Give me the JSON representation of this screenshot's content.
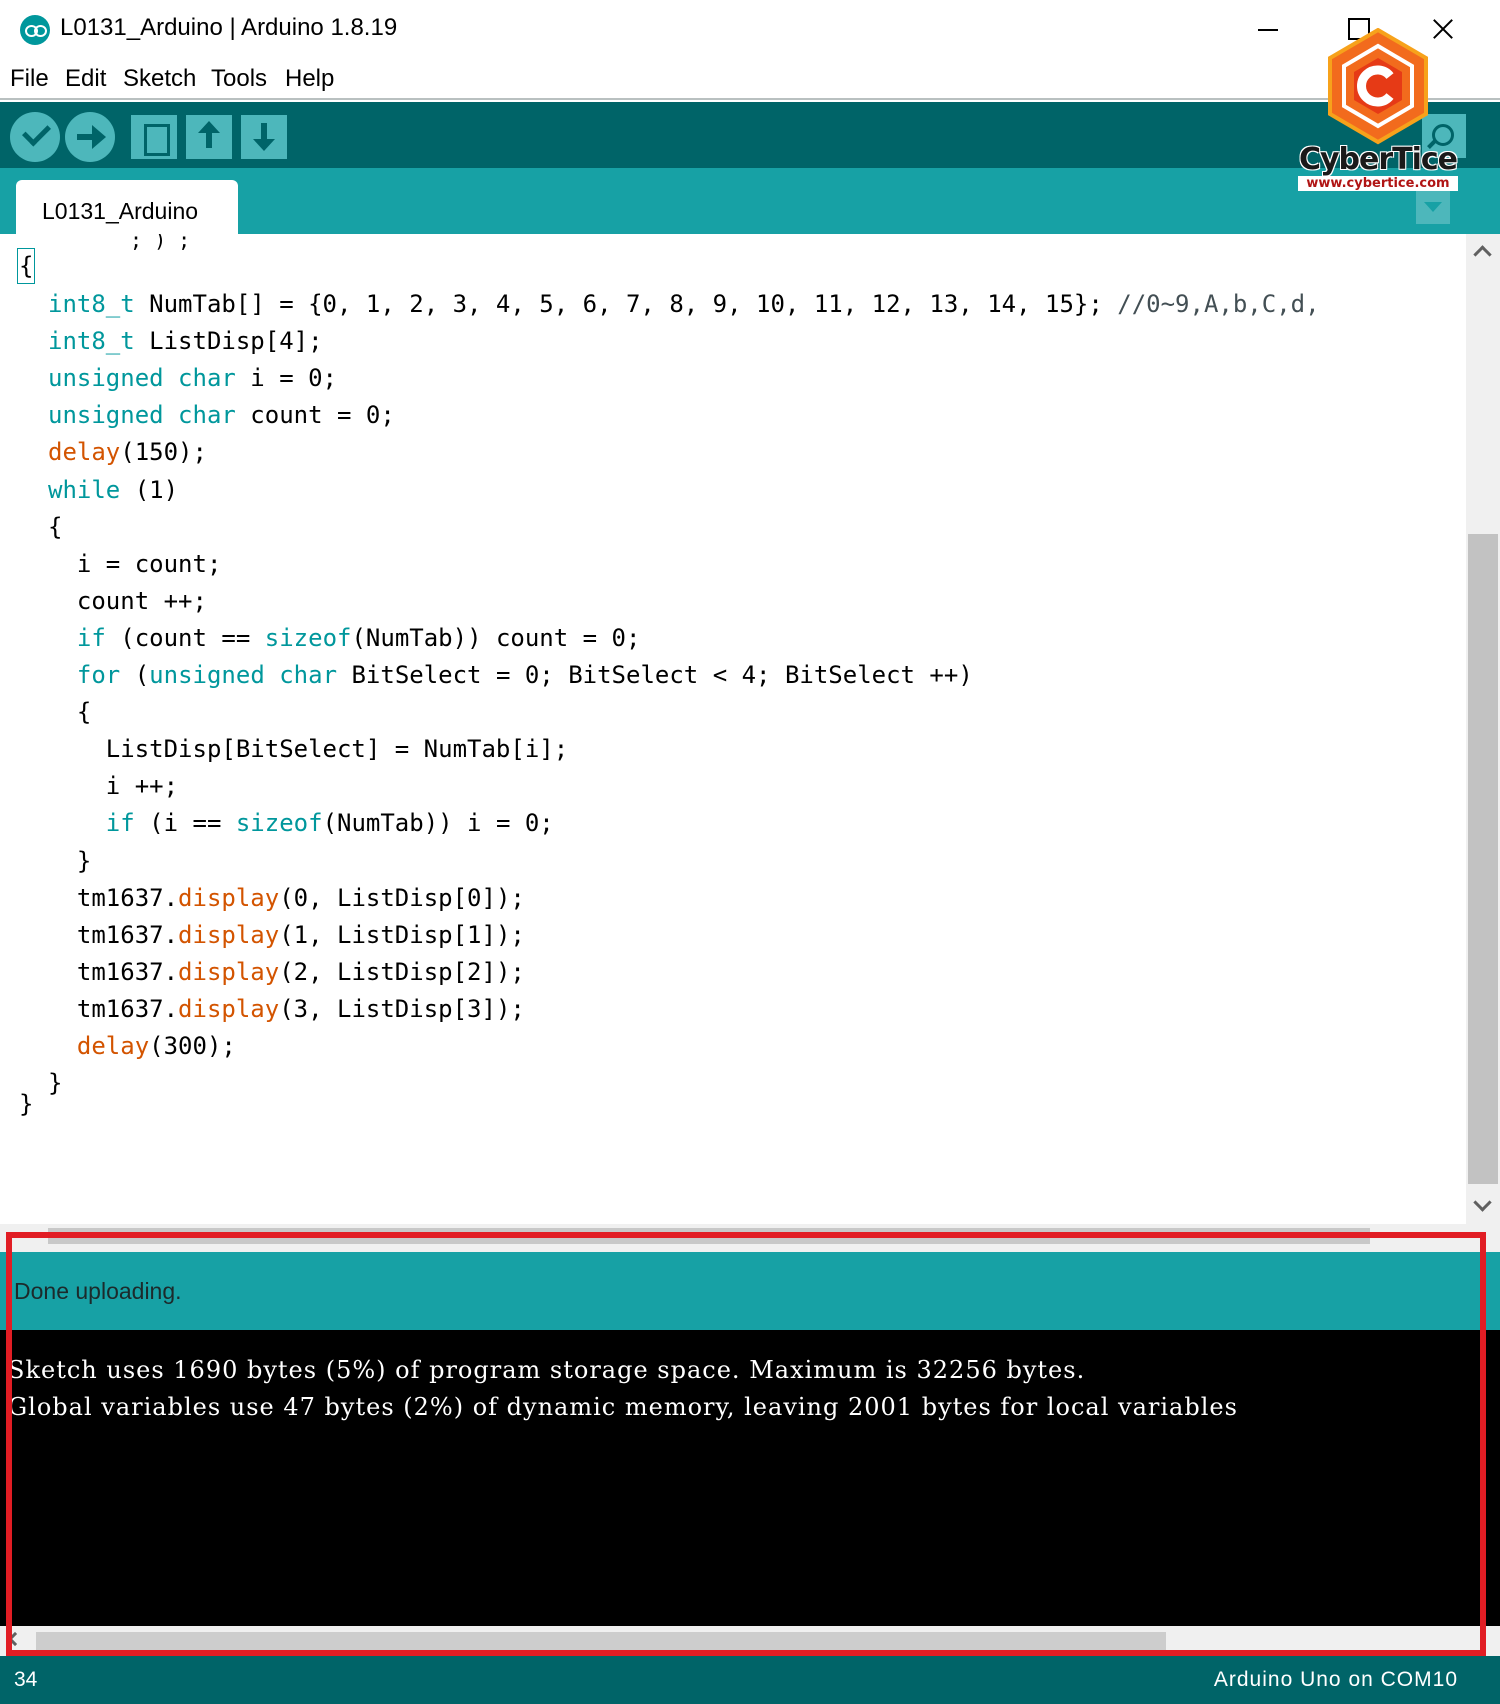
{
  "window": {
    "title": "L0131_Arduino | Arduino 1.8.19",
    "app_icon": "arduino-icon"
  },
  "menu": [
    "File",
    "Edit",
    "Sketch",
    "Tools",
    "Help"
  ],
  "toolbar": {
    "buttons": [
      "verify-icon",
      "upload-icon",
      "new-icon",
      "open-icon",
      "save-icon"
    ],
    "serial_monitor": "serial-monitor-icon"
  },
  "tabs": {
    "active": "L0131_Arduino"
  },
  "editor": {
    "clipped_top_text": "; ) ;",
    "open_brace": "{",
    "lines": [
      [
        {
          "t": "int8_t",
          "c": "k"
        },
        {
          "t": " NumTab[] = {0, 1, 2, 3, 4, 5, 6, 7, 8, 9, 10, 11, 12, 13, 14, 15}; ",
          "c": "p"
        },
        {
          "t": "//0~9,A,b,C,d,",
          "c": "c"
        }
      ],
      [
        {
          "t": "int8_t",
          "c": "k"
        },
        {
          "t": " ListDisp[4];",
          "c": "p"
        }
      ],
      [
        {
          "t": "unsigned",
          "c": "k"
        },
        {
          "t": " ",
          "c": "p"
        },
        {
          "t": "char",
          "c": "k"
        },
        {
          "t": " i = 0;",
          "c": "p"
        }
      ],
      [
        {
          "t": "unsigned",
          "c": "k"
        },
        {
          "t": " ",
          "c": "p"
        },
        {
          "t": "char",
          "c": "k"
        },
        {
          "t": " count = 0;",
          "c": "p"
        }
      ],
      [
        {
          "t": "delay",
          "c": "f"
        },
        {
          "t": "(150);",
          "c": "p"
        }
      ],
      [
        {
          "t": "while",
          "c": "k"
        },
        {
          "t": " (1)",
          "c": "p"
        }
      ],
      [
        {
          "t": "{",
          "c": "p"
        }
      ],
      [
        {
          "t": "  i = count;",
          "c": "p"
        }
      ],
      [
        {
          "t": "  count ++;",
          "c": "p"
        }
      ],
      [
        {
          "t": "  ",
          "c": "p"
        },
        {
          "t": "if",
          "c": "k"
        },
        {
          "t": " (count == ",
          "c": "p"
        },
        {
          "t": "sizeof",
          "c": "k"
        },
        {
          "t": "(NumTab)) count = 0;",
          "c": "p"
        }
      ],
      [
        {
          "t": "  ",
          "c": "p"
        },
        {
          "t": "for",
          "c": "k"
        },
        {
          "t": " (",
          "c": "p"
        },
        {
          "t": "unsigned",
          "c": "k"
        },
        {
          "t": " ",
          "c": "p"
        },
        {
          "t": "char",
          "c": "k"
        },
        {
          "t": " BitSelect = 0; BitSelect < 4; BitSelect ++)",
          "c": "p"
        }
      ],
      [
        {
          "t": "  {",
          "c": "p"
        }
      ],
      [
        {
          "t": "    ListDisp[BitSelect] = NumTab[i];",
          "c": "p"
        }
      ],
      [
        {
          "t": "    i ++;",
          "c": "p"
        }
      ],
      [
        {
          "t": "    ",
          "c": "p"
        },
        {
          "t": "if",
          "c": "k"
        },
        {
          "t": " (i == ",
          "c": "p"
        },
        {
          "t": "sizeof",
          "c": "k"
        },
        {
          "t": "(NumTab)) i = 0;",
          "c": "p"
        }
      ],
      [
        {
          "t": "  }",
          "c": "p"
        }
      ],
      [
        {
          "t": "  tm1637.",
          "c": "p"
        },
        {
          "t": "display",
          "c": "f"
        },
        {
          "t": "(0, ListDisp[0]);",
          "c": "p"
        }
      ],
      [
        {
          "t": "  tm1637.",
          "c": "p"
        },
        {
          "t": "display",
          "c": "f"
        },
        {
          "t": "(1, ListDisp[1]);",
          "c": "p"
        }
      ],
      [
        {
          "t": "  tm1637.",
          "c": "p"
        },
        {
          "t": "display",
          "c": "f"
        },
        {
          "t": "(2, ListDisp[2]);",
          "c": "p"
        }
      ],
      [
        {
          "t": "  tm1637.",
          "c": "p"
        },
        {
          "t": "display",
          "c": "f"
        },
        {
          "t": "(3, ListDisp[3]);",
          "c": "p"
        }
      ],
      [
        {
          "t": "  ",
          "c": "p"
        },
        {
          "t": "delay",
          "c": "f"
        },
        {
          "t": "(300);",
          "c": "p"
        }
      ],
      [
        {
          "t": "}",
          "c": "p"
        }
      ]
    ],
    "closing_brace": "}"
  },
  "console": {
    "status": "Done uploading.",
    "lines": [
      "Sketch uses 1690 bytes (5%) of program storage space. Maximum is 32256 bytes.",
      "Global variables use 47 bytes (2%) of dynamic memory, leaving 2001 bytes for local variables"
    ]
  },
  "footer": {
    "line_number": "34",
    "board": "Arduino Uno on COM10"
  },
  "watermark": {
    "name": "CyberTice",
    "url": "www.cybertice.com"
  },
  "colors": {
    "keyword": "#00979c",
    "function": "#d35400",
    "comment": "#434f54",
    "toolbar": "#006468",
    "tabstrip": "#17a1a5",
    "highlight": "#e11d24"
  }
}
